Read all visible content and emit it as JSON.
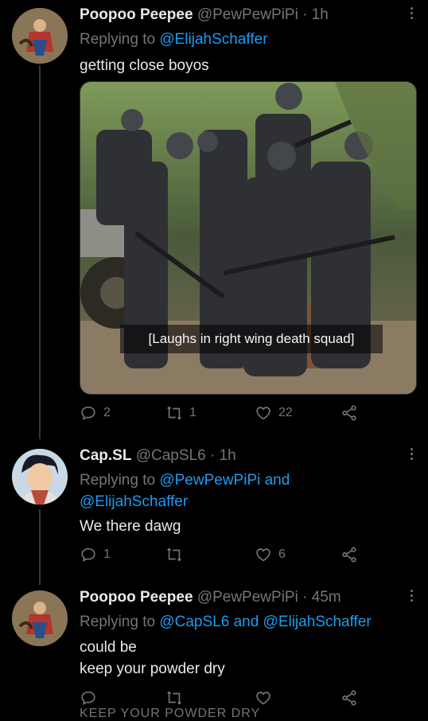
{
  "tweets": [
    {
      "name": "Poopoo Peepee",
      "handle": "@PewPewPiPi",
      "separator": "·",
      "time": "1h",
      "replying_prefix": "Replying to",
      "mentions_line1": "@ElijahSchaffer",
      "text": "getting close boyos",
      "media_caption": "[Laughs in right wing death squad]",
      "replies": "2",
      "retweets": "1",
      "likes": "22"
    },
    {
      "name": "Cap.SL",
      "handle": "@CapSL6",
      "separator": "·",
      "time": "1h",
      "replying_prefix": "Replying to",
      "mentions_line1": "@PewPewPiPi and",
      "mentions_line2": "@ElijahSchaffer",
      "text": "We there dawg",
      "replies": "1",
      "retweets": "",
      "likes": "6"
    },
    {
      "name": "Poopoo Peepee",
      "handle": "@PewPewPiPi",
      "separator": "·",
      "time": "45m",
      "replying_prefix": "Replying to",
      "mentions_line1": "@CapSL6 and @ElijahSchaffer",
      "text_line1": "could be",
      "text_line2": "keep your powder dry",
      "replies": "",
      "retweets": "",
      "likes": ""
    }
  ],
  "cut_off_text": "KEEP YOUR POWDER DRY",
  "icons": {
    "reply": "reply-icon",
    "retweet": "retweet-icon",
    "like": "heart-icon",
    "share": "share-icon",
    "more": "more-icon"
  },
  "colors": {
    "background": "#000000",
    "text": "#e7e9ea",
    "secondary": "#71767b",
    "link": "#1d9bf0"
  }
}
